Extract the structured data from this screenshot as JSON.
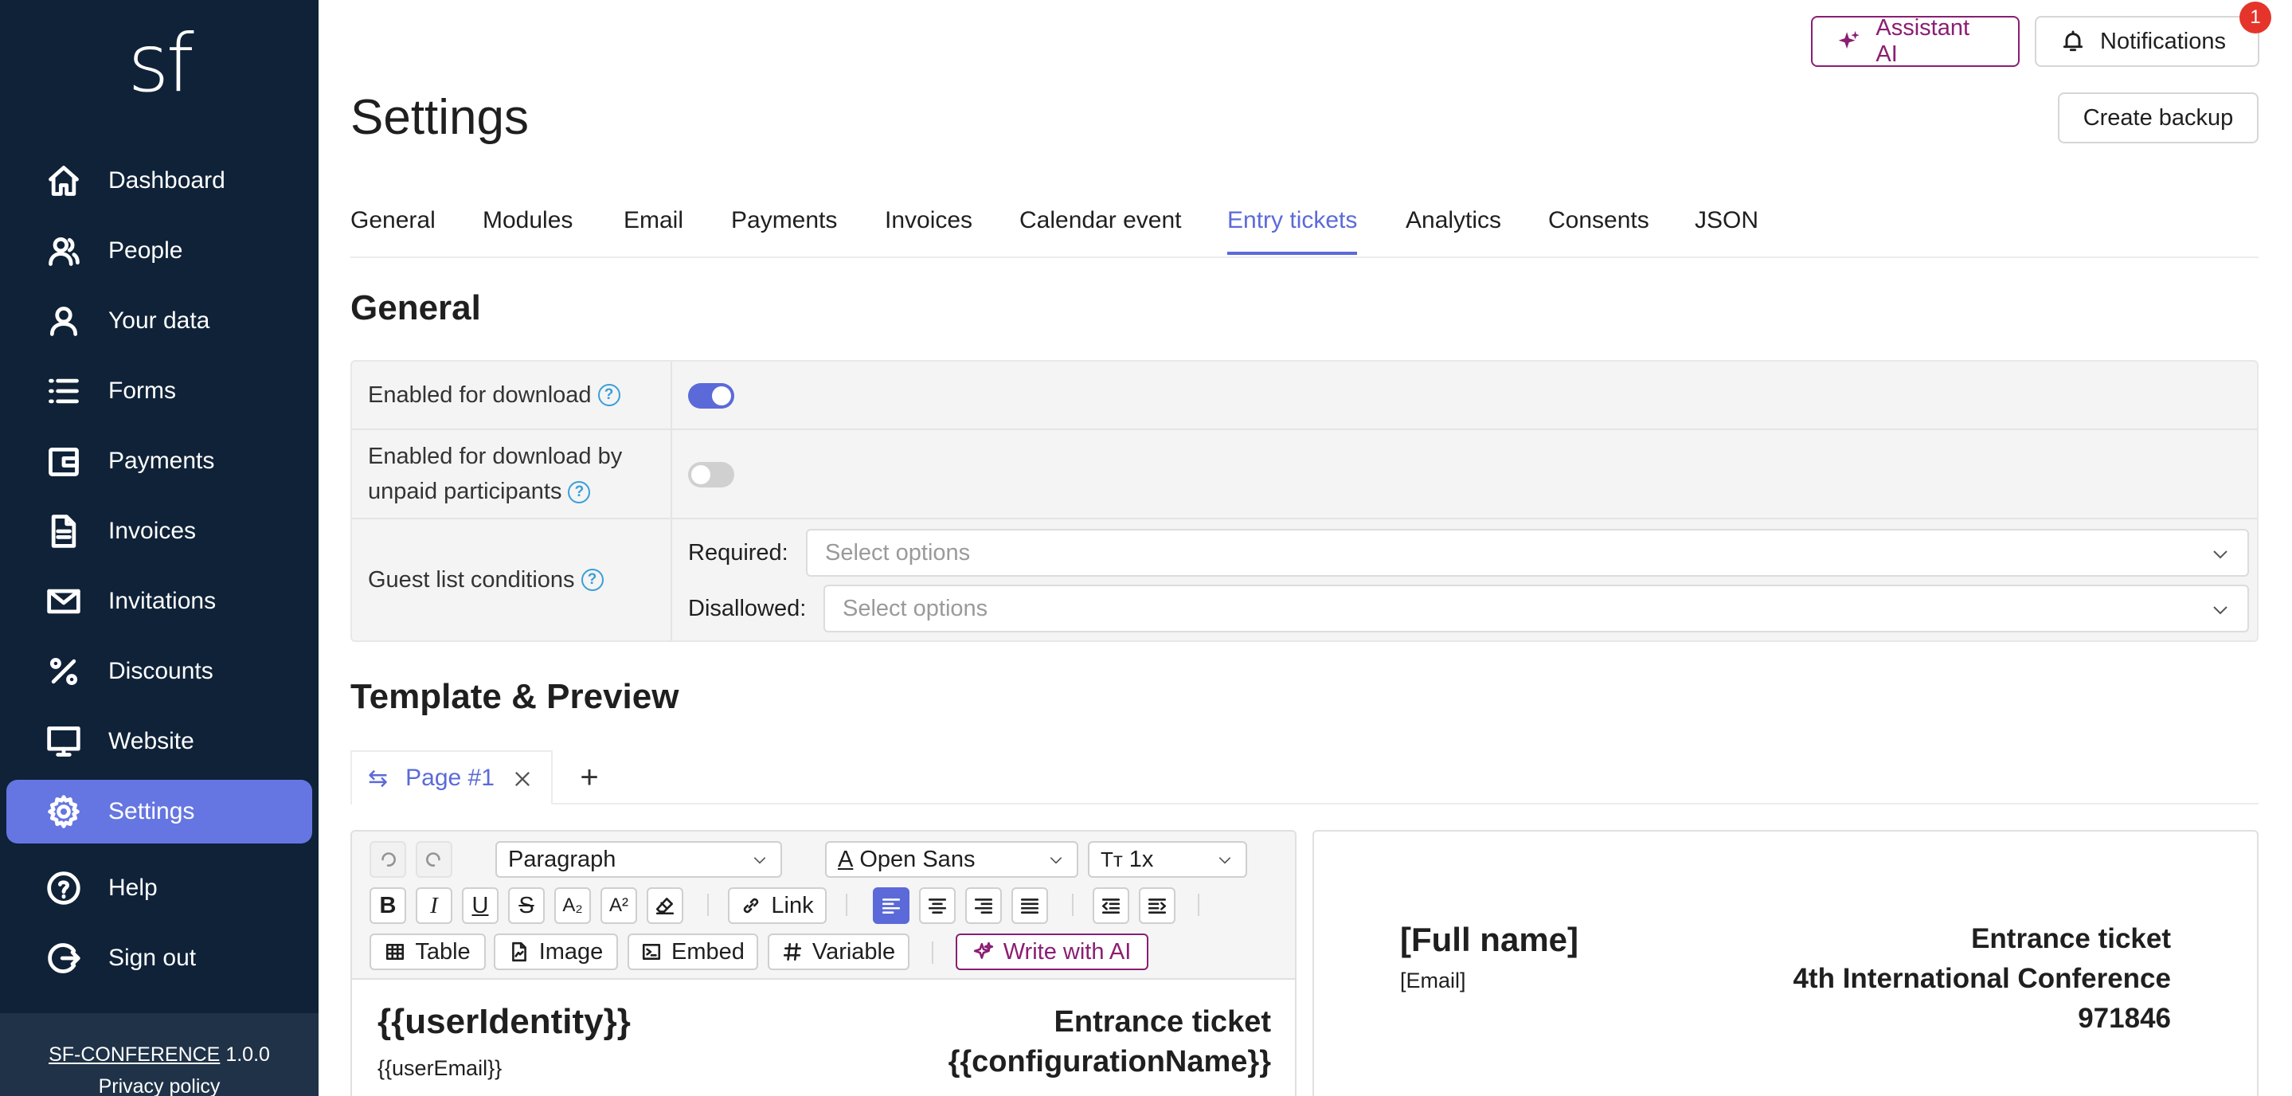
{
  "sidebar": {
    "logo": "sf",
    "items": [
      {
        "label": "Dashboard",
        "icon": "home-icon"
      },
      {
        "label": "People",
        "icon": "people-icon"
      },
      {
        "label": "Your data",
        "icon": "user-icon"
      },
      {
        "label": "Forms",
        "icon": "list-icon"
      },
      {
        "label": "Payments",
        "icon": "wallet-icon"
      },
      {
        "label": "Invoices",
        "icon": "document-icon"
      },
      {
        "label": "Invitations",
        "icon": "envelope-icon"
      },
      {
        "label": "Discounts",
        "icon": "percent-icon"
      },
      {
        "label": "Website",
        "icon": "monitor-icon"
      },
      {
        "label": "Settings",
        "icon": "gear-icon",
        "active": true
      },
      {
        "label": "Help",
        "icon": "help-icon"
      },
      {
        "label": "Sign out",
        "icon": "sign-out-icon"
      }
    ],
    "footer": {
      "app_name": "SF-CONFERENCE",
      "version": "1.0.0",
      "privacy": "Privacy policy"
    }
  },
  "header": {
    "assistant_label": "Assistant AI",
    "notifications_label": "Notifications",
    "notifications_count": "1",
    "backup_label": "Create backup"
  },
  "page_title": "Settings",
  "tabs": [
    "General",
    "Modules",
    "Email",
    "Payments",
    "Invoices",
    "Calendar event",
    "Entry tickets",
    "Analytics",
    "Consents",
    "JSON"
  ],
  "active_tab": "Entry tickets",
  "general": {
    "title": "General",
    "enabled_download": {
      "label": "Enabled for download",
      "value": true
    },
    "enabled_unpaid": {
      "label_line1": "Enabled for download by",
      "label_line2": "unpaid participants",
      "value": false
    },
    "guest_conditions": {
      "label": "Guest list conditions",
      "required_label": "Required:",
      "required_placeholder": "Select options",
      "disallowed_label": "Disallowed:",
      "disallowed_placeholder": "Select options"
    }
  },
  "template": {
    "title": "Template & Preview",
    "page_tab": "Page #1",
    "toolbar": {
      "block_format": "Paragraph",
      "font": "Open Sans",
      "size": "1x",
      "link": "Link",
      "table": "Table",
      "image": "Image",
      "embed": "Embed",
      "variable": "Variable",
      "write_ai": "Write with AI"
    },
    "editor": {
      "name": "{{userIdentity}}",
      "email": "{{userEmail}}",
      "ticket_title": "Entrance ticket",
      "config_name": "{{configurationName}}"
    },
    "preview": {
      "name": "[Full name]",
      "email": "[Email]",
      "ticket_title": "Entrance ticket",
      "conference": "4th International Conference",
      "code": "971846"
    }
  },
  "colors": {
    "sidebar_bg": "#0f2238",
    "accent": "#5b6ad8",
    "ai_accent": "#8a1e73",
    "badge": "#e5352b"
  }
}
